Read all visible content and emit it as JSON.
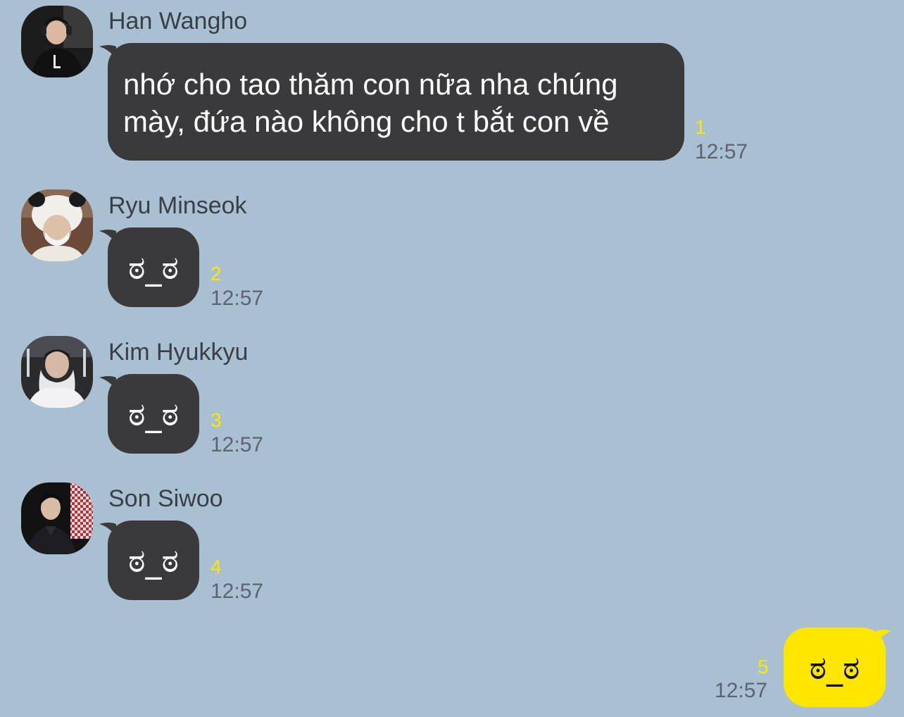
{
  "messages": [
    {
      "sender": "Han Wangho",
      "avatar_icon": "avatar-han-wangho",
      "text": "nhớ cho tao thăm con nữa nha chúng\nmày, đứa nào không cho t bắt con về",
      "unread": "1",
      "time": "12:57"
    },
    {
      "sender": "Ryu Minseok",
      "avatar_icon": "avatar-ryu-minseok",
      "text": "ಠ_ಠ",
      "unread": "2",
      "time": "12:57"
    },
    {
      "sender": "Kim Hyukkyu",
      "avatar_icon": "avatar-kim-hyukkyu",
      "text": "ಠ_ಠ",
      "unread": "3",
      "time": "12:57"
    },
    {
      "sender": "Son Siwoo",
      "avatar_icon": "avatar-son-siwoo",
      "text": "ಠ_ಠ",
      "unread": "4",
      "time": "12:57"
    }
  ],
  "my_message": {
    "text": "ಠ_ಠ",
    "unread": "5",
    "time": "12:57"
  },
  "colors": {
    "background": "#a9bfd2",
    "incoming_bubble": "#3a3a3c",
    "outgoing_bubble": "#ffe600",
    "unread_count": "#ffe600"
  }
}
